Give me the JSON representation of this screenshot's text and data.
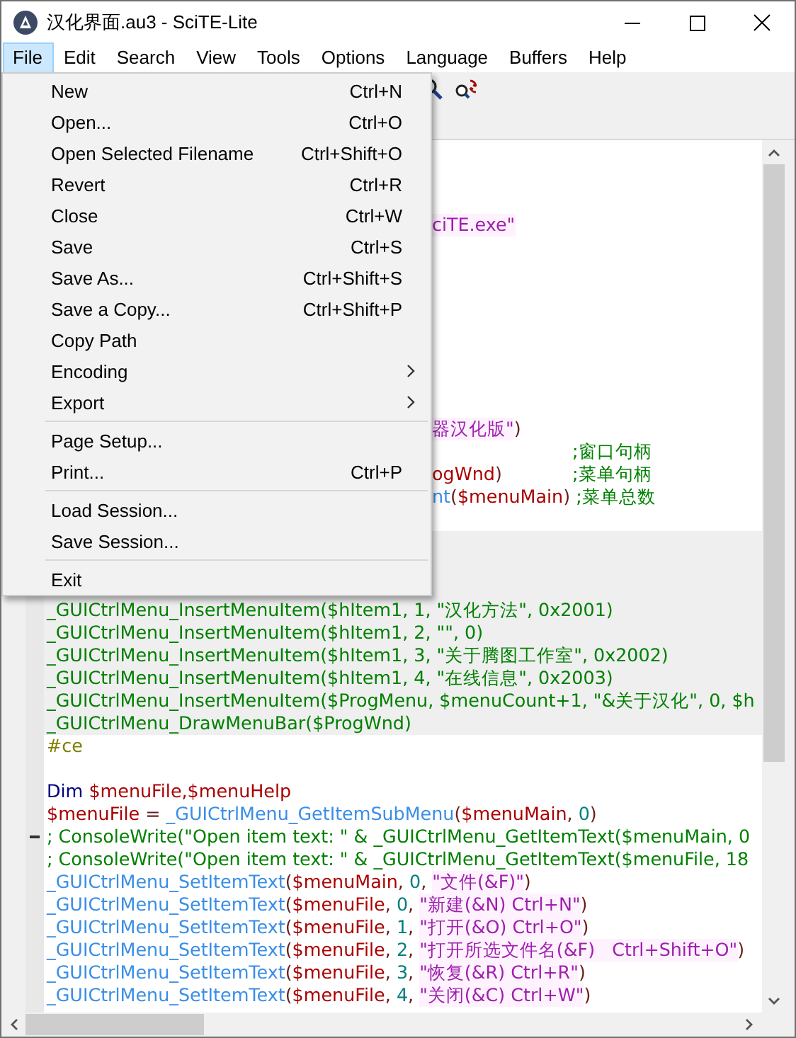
{
  "window": {
    "title": "汉化界面.au3 - SciTE-Lite"
  },
  "menubar": [
    {
      "label": "File",
      "selected": true
    },
    {
      "label": "Edit",
      "selected": false
    },
    {
      "label": "Search",
      "selected": false
    },
    {
      "label": "View",
      "selected": false
    },
    {
      "label": "Tools",
      "selected": false
    },
    {
      "label": "Options",
      "selected": false
    },
    {
      "label": "Language",
      "selected": false
    },
    {
      "label": "Buffers",
      "selected": false
    },
    {
      "label": "Help",
      "selected": false
    }
  ],
  "file_menu": [
    {
      "kind": "item",
      "label": "New",
      "shortcut": "Ctrl+N"
    },
    {
      "kind": "item",
      "label": "Open...",
      "shortcut": "Ctrl+O"
    },
    {
      "kind": "item",
      "label": "Open Selected Filename",
      "shortcut": "Ctrl+Shift+O"
    },
    {
      "kind": "item",
      "label": "Revert",
      "shortcut": "Ctrl+R"
    },
    {
      "kind": "item",
      "label": "Close",
      "shortcut": "Ctrl+W"
    },
    {
      "kind": "item",
      "label": "Save",
      "shortcut": "Ctrl+S"
    },
    {
      "kind": "item",
      "label": "Save As...",
      "shortcut": "Ctrl+Shift+S"
    },
    {
      "kind": "item",
      "label": "Save a Copy...",
      "shortcut": "Ctrl+Shift+P"
    },
    {
      "kind": "item",
      "label": "Copy Path"
    },
    {
      "kind": "submenu",
      "label": "Encoding"
    },
    {
      "kind": "submenu",
      "label": "Export"
    },
    {
      "kind": "separator"
    },
    {
      "kind": "item",
      "label": "Page Setup..."
    },
    {
      "kind": "item",
      "label": "Print...",
      "shortcut": "Ctrl+P"
    },
    {
      "kind": "separator"
    },
    {
      "kind": "item",
      "label": "Load Session..."
    },
    {
      "kind": "item",
      "label": "Save Session..."
    },
    {
      "kind": "separator"
    },
    {
      "kind": "item",
      "label": "Exit"
    }
  ],
  "editor": {
    "lines_behind_menu": [
      {
        "kind": "blank"
      },
      {
        "kind": "blank"
      },
      {
        "kind": "blank"
      },
      {
        "kind": "code",
        "tokens": [
          {
            "kind": "str",
            "text": "ciTE.exe\""
          }
        ]
      },
      {
        "kind": "blank"
      },
      {
        "kind": "blank"
      },
      {
        "kind": "blank"
      },
      {
        "kind": "blank"
      },
      {
        "kind": "blank"
      },
      {
        "kind": "blank"
      },
      {
        "kind": "blank"
      },
      {
        "kind": "blank"
      },
      {
        "kind": "code",
        "tokens": [
          {
            "kind": "str",
            "text": "器汉化版\""
          },
          {
            "kind": "op",
            "text": ")"
          }
        ]
      },
      {
        "kind": "code",
        "tokens": [
          {
            "kind": "col_comment",
            "text": ";窗口句柄"
          }
        ]
      },
      {
        "kind": "code",
        "tokens": [
          {
            "kind": "var",
            "text": "ogWnd"
          },
          {
            "kind": "op",
            "text": ")"
          },
          {
            "kind": "col_comment",
            "text": ";菜单句柄"
          }
        ]
      },
      {
        "kind": "code",
        "tokens": [
          {
            "kind": "func",
            "text": "nt"
          },
          {
            "kind": "op",
            "text": "("
          },
          {
            "kind": "var",
            "text": "$menuMain"
          },
          {
            "kind": "op",
            "text": ")"
          },
          {
            "kind": "comment",
            "text": " ;菜单总数"
          }
        ]
      },
      {
        "kind": "blank"
      },
      {
        "kind": "blank",
        "highlighted": true
      },
      {
        "kind": "blank",
        "highlighted": true
      },
      {
        "kind": "blank",
        "highlighted": true
      }
    ],
    "lines": [
      {
        "kind": "code",
        "highlighted": true,
        "tokens": [
          {
            "kind": "comment",
            "text": "_GUICtrlMenu_InsertMenuItem($hItem1, 1, \"汉化方法\", 0x2001)"
          }
        ]
      },
      {
        "kind": "code",
        "highlighted": true,
        "tokens": [
          {
            "kind": "comment",
            "text": "_GUICtrlMenu_InsertMenuItem($hItem1, 2, \"\", 0)"
          }
        ]
      },
      {
        "kind": "code",
        "highlighted": true,
        "tokens": [
          {
            "kind": "comment",
            "text": "_GUICtrlMenu_InsertMenuItem($hItem1, 3, \"关于腾图工作室\", 0x2002)"
          }
        ]
      },
      {
        "kind": "code",
        "highlighted": true,
        "tokens": [
          {
            "kind": "comment",
            "text": "_GUICtrlMenu_InsertMenuItem($hItem1, 4, \"在线信息\", 0x2003)"
          }
        ]
      },
      {
        "kind": "code",
        "highlighted": true,
        "tokens": [
          {
            "kind": "comment",
            "text": "_GUICtrlMenu_InsertMenuItem($ProgMenu, $menuCount+1, \"&关于汉化\", 0, $h"
          }
        ]
      },
      {
        "kind": "code",
        "highlighted": true,
        "tokens": [
          {
            "kind": "comment",
            "text": "_GUICtrlMenu_DrawMenuBar($ProgWnd)"
          }
        ]
      },
      {
        "kind": "code",
        "tokens": [
          {
            "kind": "pre",
            "text": "#ce"
          }
        ]
      },
      {
        "kind": "blank"
      },
      {
        "kind": "code",
        "tokens": [
          {
            "kind": "kw",
            "text": "Dim"
          },
          {
            "kind": "var",
            "text": "$menuFile,$menuHelp"
          }
        ]
      },
      {
        "kind": "code",
        "tokens": [
          {
            "kind": "var",
            "text": "$menuFile"
          },
          {
            "kind": "op",
            "text": " = "
          },
          {
            "kind": "func",
            "text": "_GUICtrlMenu_GetItemSubMenu"
          },
          {
            "kind": "op",
            "text": "("
          },
          {
            "kind": "var",
            "text": "$menuMain"
          },
          {
            "kind": "op",
            "text": ", "
          },
          {
            "kind": "num",
            "text": "0"
          },
          {
            "kind": "op",
            "text": ")"
          }
        ]
      },
      {
        "kind": "code",
        "fold": true,
        "tokens": [
          {
            "kind": "comment",
            "text": "; ConsoleWrite(\"Open item text: \" & _GUICtrlMenu_GetItemText($menuMain, 0"
          }
        ]
      },
      {
        "kind": "code",
        "tokens": [
          {
            "kind": "comment",
            "text": "; ConsoleWrite(\"Open item text: \" & _GUICtrlMenu_GetItemText($menuFile, 18"
          }
        ]
      },
      {
        "kind": "code",
        "tokens": [
          {
            "kind": "func",
            "text": "_GUICtrlMenu_SetItemText"
          },
          {
            "kind": "op",
            "text": "("
          },
          {
            "kind": "var",
            "text": "$menuMain"
          },
          {
            "kind": "op",
            "text": ", "
          },
          {
            "kind": "num",
            "text": "0"
          },
          {
            "kind": "op",
            "text": ", "
          },
          {
            "kind": "str",
            "text": "\"文件(&F)\""
          },
          {
            "kind": "op",
            "text": ")"
          }
        ]
      },
      {
        "kind": "code",
        "tokens": [
          {
            "kind": "func",
            "text": "_GUICtrlMenu_SetItemText"
          },
          {
            "kind": "op",
            "text": "("
          },
          {
            "kind": "var",
            "text": "$menuFile"
          },
          {
            "kind": "op",
            "text": ", "
          },
          {
            "kind": "num",
            "text": "0"
          },
          {
            "kind": "op",
            "text": ", "
          },
          {
            "kind": "str",
            "text": "\"新建(&N) Ctrl+N\""
          },
          {
            "kind": "op",
            "text": ")"
          }
        ]
      },
      {
        "kind": "code",
        "tokens": [
          {
            "kind": "func",
            "text": "_GUICtrlMenu_SetItemText"
          },
          {
            "kind": "op",
            "text": "("
          },
          {
            "kind": "var",
            "text": "$menuFile"
          },
          {
            "kind": "op",
            "text": ", "
          },
          {
            "kind": "num",
            "text": "1"
          },
          {
            "kind": "op",
            "text": ", "
          },
          {
            "kind": "str",
            "text": "\"打开(&O) Ctrl+O\""
          },
          {
            "kind": "op",
            "text": ")"
          }
        ]
      },
      {
        "kind": "code",
        "tokens": [
          {
            "kind": "func",
            "text": "_GUICtrlMenu_SetItemText"
          },
          {
            "kind": "op",
            "text": "("
          },
          {
            "kind": "var",
            "text": "$menuFile"
          },
          {
            "kind": "op",
            "text": ", "
          },
          {
            "kind": "num",
            "text": "2"
          },
          {
            "kind": "op",
            "text": ", "
          },
          {
            "kind": "str",
            "text": "\"打开所选文件名(&F)   Ctrl+Shift+O\""
          },
          {
            "kind": "op",
            "text": ")"
          }
        ]
      },
      {
        "kind": "code",
        "tokens": [
          {
            "kind": "func",
            "text": "_GUICtrlMenu_SetItemText"
          },
          {
            "kind": "op",
            "text": "("
          },
          {
            "kind": "var",
            "text": "$menuFile"
          },
          {
            "kind": "op",
            "text": ", "
          },
          {
            "kind": "num",
            "text": "3"
          },
          {
            "kind": "op",
            "text": ", "
          },
          {
            "kind": "str",
            "text": "\"恢复(&R) Ctrl+R\""
          },
          {
            "kind": "op",
            "text": ")"
          }
        ]
      },
      {
        "kind": "code",
        "tokens": [
          {
            "kind": "func",
            "text": "_GUICtrlMenu_SetItemText"
          },
          {
            "kind": "op",
            "text": "("
          },
          {
            "kind": "var",
            "text": "$menuFile"
          },
          {
            "kind": "op",
            "text": ", "
          },
          {
            "kind": "num",
            "text": "4"
          },
          {
            "kind": "op",
            "text": ", "
          },
          {
            "kind": "str",
            "text": "\"关闭(&C) Ctrl+W\""
          },
          {
            "kind": "op",
            "text": ")"
          }
        ]
      }
    ]
  }
}
